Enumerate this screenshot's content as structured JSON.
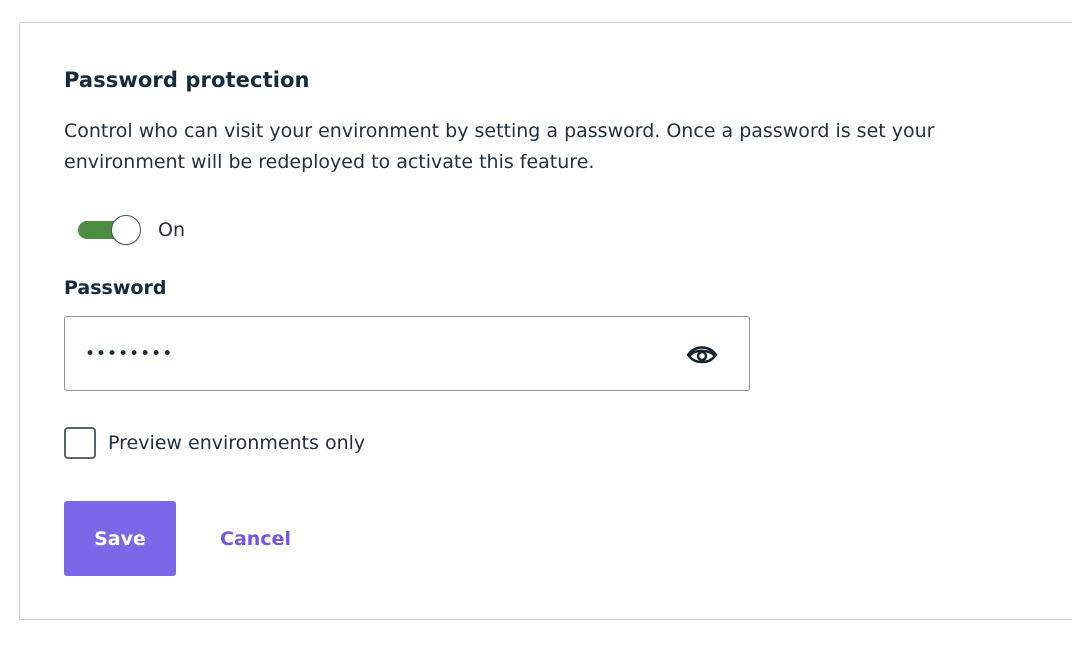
{
  "section": {
    "title": "Password protection",
    "description": "Control who can visit your environment by setting a password. Once a password is set your environment will be redeployed to activate this feature."
  },
  "toggle": {
    "state_label": "On",
    "checked": true,
    "active_color": "#4b8e43"
  },
  "password_field": {
    "label": "Password",
    "value": "secret12",
    "reveal_icon": "eye-icon"
  },
  "preview_only": {
    "label": "Preview environments only",
    "checked": false
  },
  "actions": {
    "save_label": "Save",
    "cancel_label": "Cancel",
    "primary_color": "#7b68e8"
  }
}
